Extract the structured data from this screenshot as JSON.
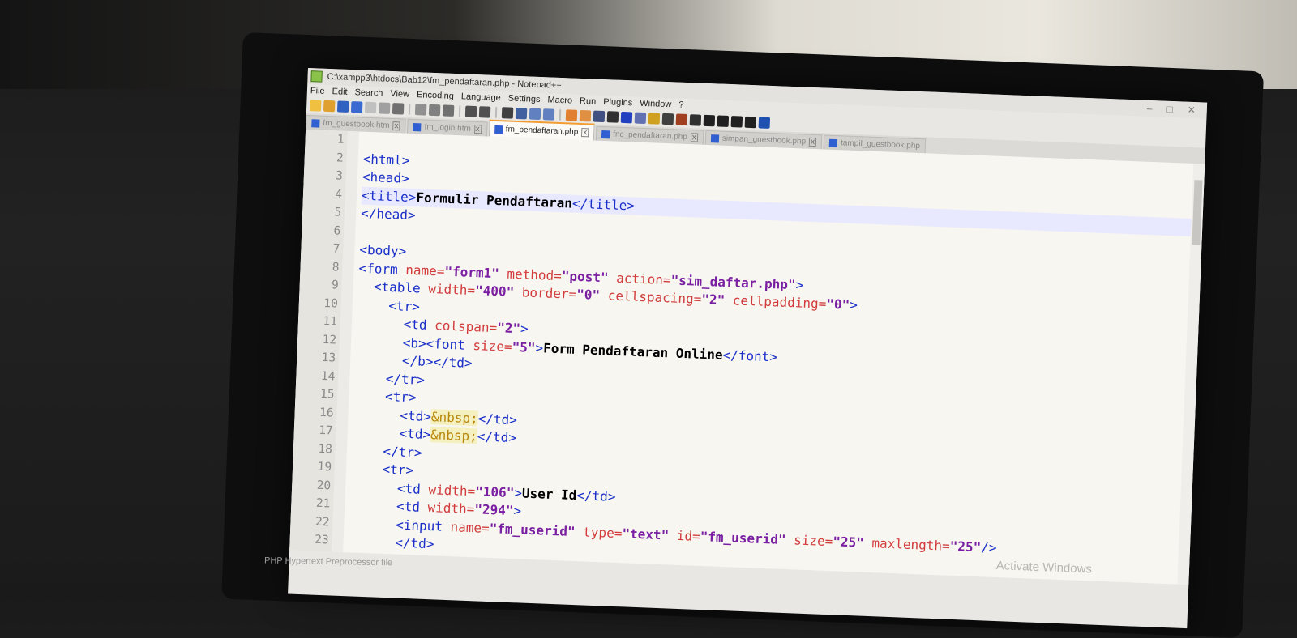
{
  "window": {
    "title": "C:\\xampp3\\htdocs\\Bab12\\fm_pendaftaran.php - Notepad++",
    "controls": [
      "–",
      "□",
      "✕"
    ]
  },
  "menu": [
    "File",
    "Edit",
    "Search",
    "View",
    "Encoding",
    "Language",
    "Settings",
    "Macro",
    "Run",
    "Plugins",
    "Window",
    "?"
  ],
  "tabs": [
    {
      "label": "fm_guestbook.htm",
      "active": false
    },
    {
      "label": "fm_login.htm",
      "active": false
    },
    {
      "label": "fm_pendaftaran.php",
      "active": true
    },
    {
      "label": "fnc_pendaftaran.php",
      "active": false
    },
    {
      "label": "simpan_guestbook.php",
      "active": false
    },
    {
      "label": "tampil_guestbook.php",
      "active": false
    }
  ],
  "line_numbers": [
    "1",
    "2",
    "3",
    "4",
    "5",
    "6",
    "7",
    "8",
    "9",
    "10",
    "11",
    "12",
    "13",
    "14",
    "15",
    "16",
    "17",
    "18",
    "19",
    "20",
    "21",
    "22",
    "23"
  ],
  "overlay": {
    "activate_windows": "Activate Windows"
  },
  "status_bar": {
    "file_type": "PHP Hypertext Preprocessor file"
  },
  "icons": {
    "app": "notepadpp-icon",
    "file": "php-file-icon"
  }
}
